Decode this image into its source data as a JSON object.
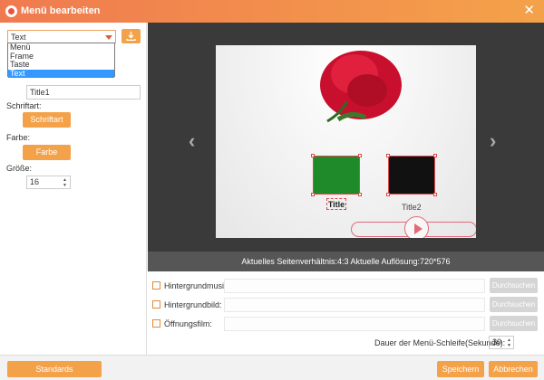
{
  "window": {
    "title": "Menü bearbeiten",
    "close_icon": "close-icon",
    "logo_icon": "app-logo-icon"
  },
  "left": {
    "element_select": {
      "value": "Text",
      "options": [
        "Menü",
        "Frame",
        "Taste",
        "Text"
      ],
      "selected": "Text"
    },
    "import_icon": "download-icon",
    "name_value": "Title1",
    "font_label": "Schriftart:",
    "font_button": "Schriftart",
    "color_label": "Farbe:",
    "color_button": "Farbe",
    "size_label": "Größe:",
    "size_value": "16"
  },
  "preview": {
    "thumb2_label": "Title2",
    "thumb1_label": "Title"
  },
  "status": {
    "text": "Aktuelles Seitenverhältnis:4:3    Aktuelle Auflösung:720*576"
  },
  "settings": {
    "music_label": "Hintergrundmusik:",
    "image_label": "Hintergrundbild:",
    "film_label": "Öffnungsfilm:",
    "browse_label": "Durchsuchen",
    "loop_label": "Dauer der Menü-Schleife(Sekunde):",
    "loop_value": "30"
  },
  "footer": {
    "reset": "Standards wiederherstellen",
    "save": "Speichern",
    "cancel": "Abbrechen"
  },
  "colors": {
    "accent": "#f4a24a",
    "titlebar_start": "#f07a4f",
    "titlebar_end": "#f4a24a"
  }
}
